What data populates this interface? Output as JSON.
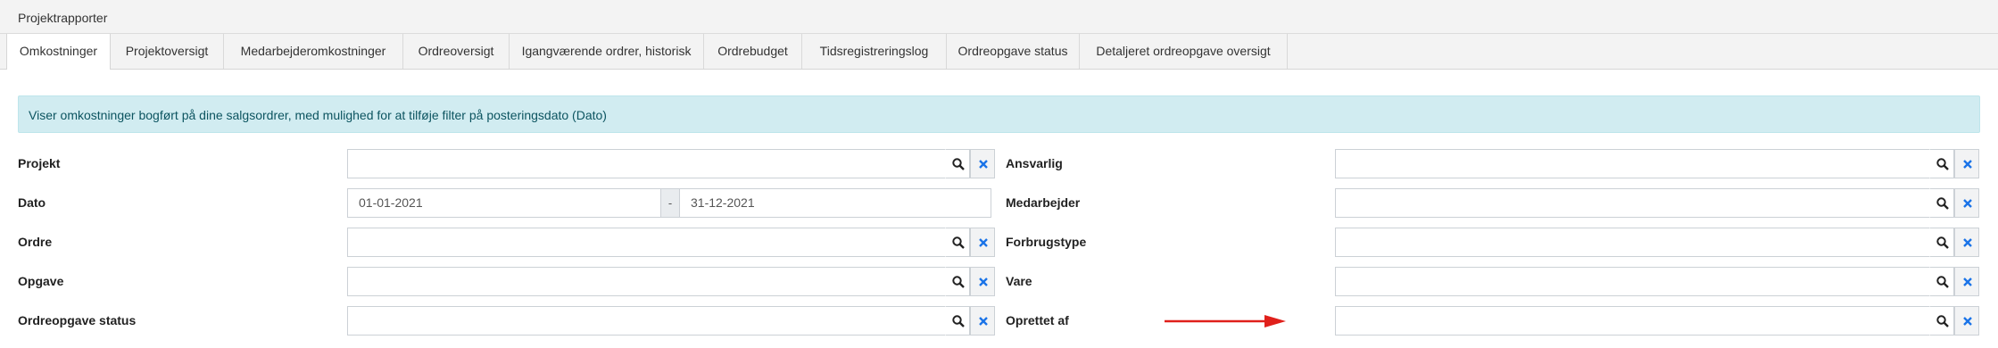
{
  "panel": {
    "title": "Projektrapporter"
  },
  "tabs": [
    "Omkostninger",
    "Projektoversigt",
    "Medarbejderomkostninger",
    "Ordreoversigt",
    "Igangværende ordrer, historisk",
    "Ordrebudget",
    "Tidsregistreringslog",
    "Ordreopgave status",
    "Detaljeret ordreopgave oversigt"
  ],
  "active_tab": "Omkostninger",
  "info_alert": "Viser omkostninger bogført på dine salgsordrer, med mulighed for at tilføje filter på posteringsdato (Dato)",
  "left_filters": {
    "projekt": {
      "label": "Projekt",
      "value": ""
    },
    "dato": {
      "label": "Dato",
      "from": "01-01-2021",
      "separator": "-",
      "to": "31-12-2021"
    },
    "ordre": {
      "label": "Ordre",
      "value": ""
    },
    "opgave": {
      "label": "Opgave",
      "value": ""
    },
    "ordreopgave_status": {
      "label": "Ordreopgave status",
      "value": ""
    }
  },
  "right_filters": {
    "ansvarlig": {
      "label": "Ansvarlig",
      "value": ""
    },
    "medarbejder": {
      "label": "Medarbejder",
      "value": ""
    },
    "forbrugstype": {
      "label": "Forbrugstype",
      "value": ""
    },
    "vare": {
      "label": "Vare",
      "value": ""
    },
    "oprettet_af": {
      "label": "Oprettet af",
      "value": ""
    }
  },
  "icons": {
    "search": "search-icon",
    "clear": "close-icon",
    "annotation": "red-arrow-icon"
  },
  "colors": {
    "alert_bg": "#d1ecf1",
    "alert_text": "#0c5460",
    "clear_icon": "#1a73e8",
    "arrow": "#e0201b"
  }
}
